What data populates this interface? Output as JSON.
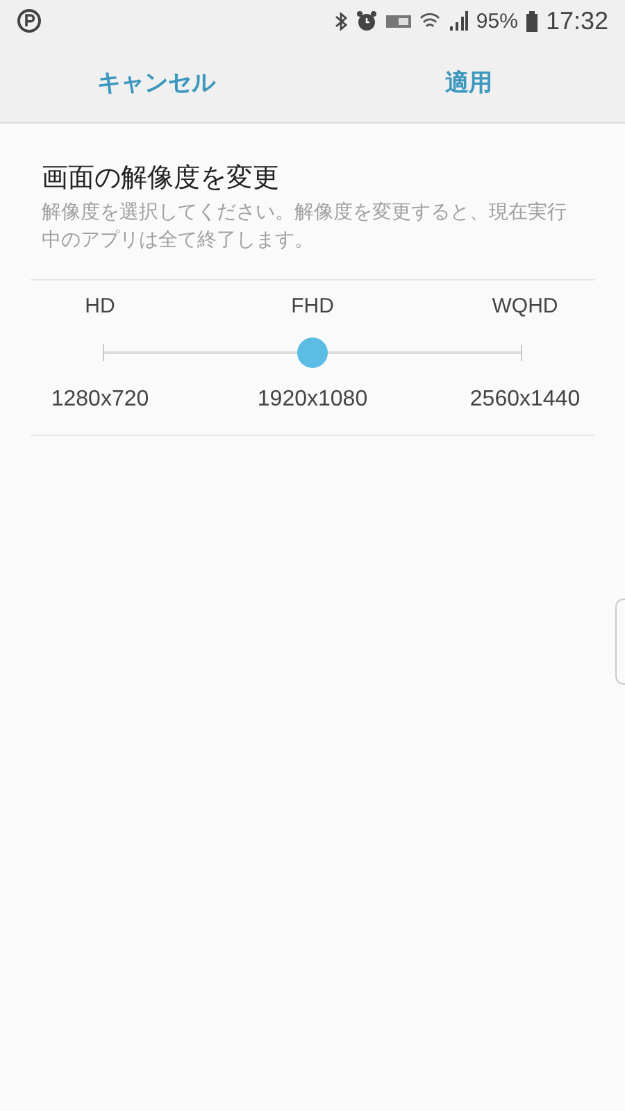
{
  "status_bar": {
    "battery": "95%",
    "time": "17:32"
  },
  "header": {
    "cancel": "キャンセル",
    "apply": "適用"
  },
  "setting": {
    "title": "画面の解像度を変更",
    "description": "解像度を選択してください。解像度を変更すると、現在実行中のアプリは全て終了します。"
  },
  "resolution": {
    "level": 0.5,
    "options": [
      {
        "name": "HD",
        "size": "1280x720"
      },
      {
        "name": "FHD",
        "size": "1920x1080"
      },
      {
        "name": "WQHD",
        "size": "2560x1440"
      }
    ]
  }
}
